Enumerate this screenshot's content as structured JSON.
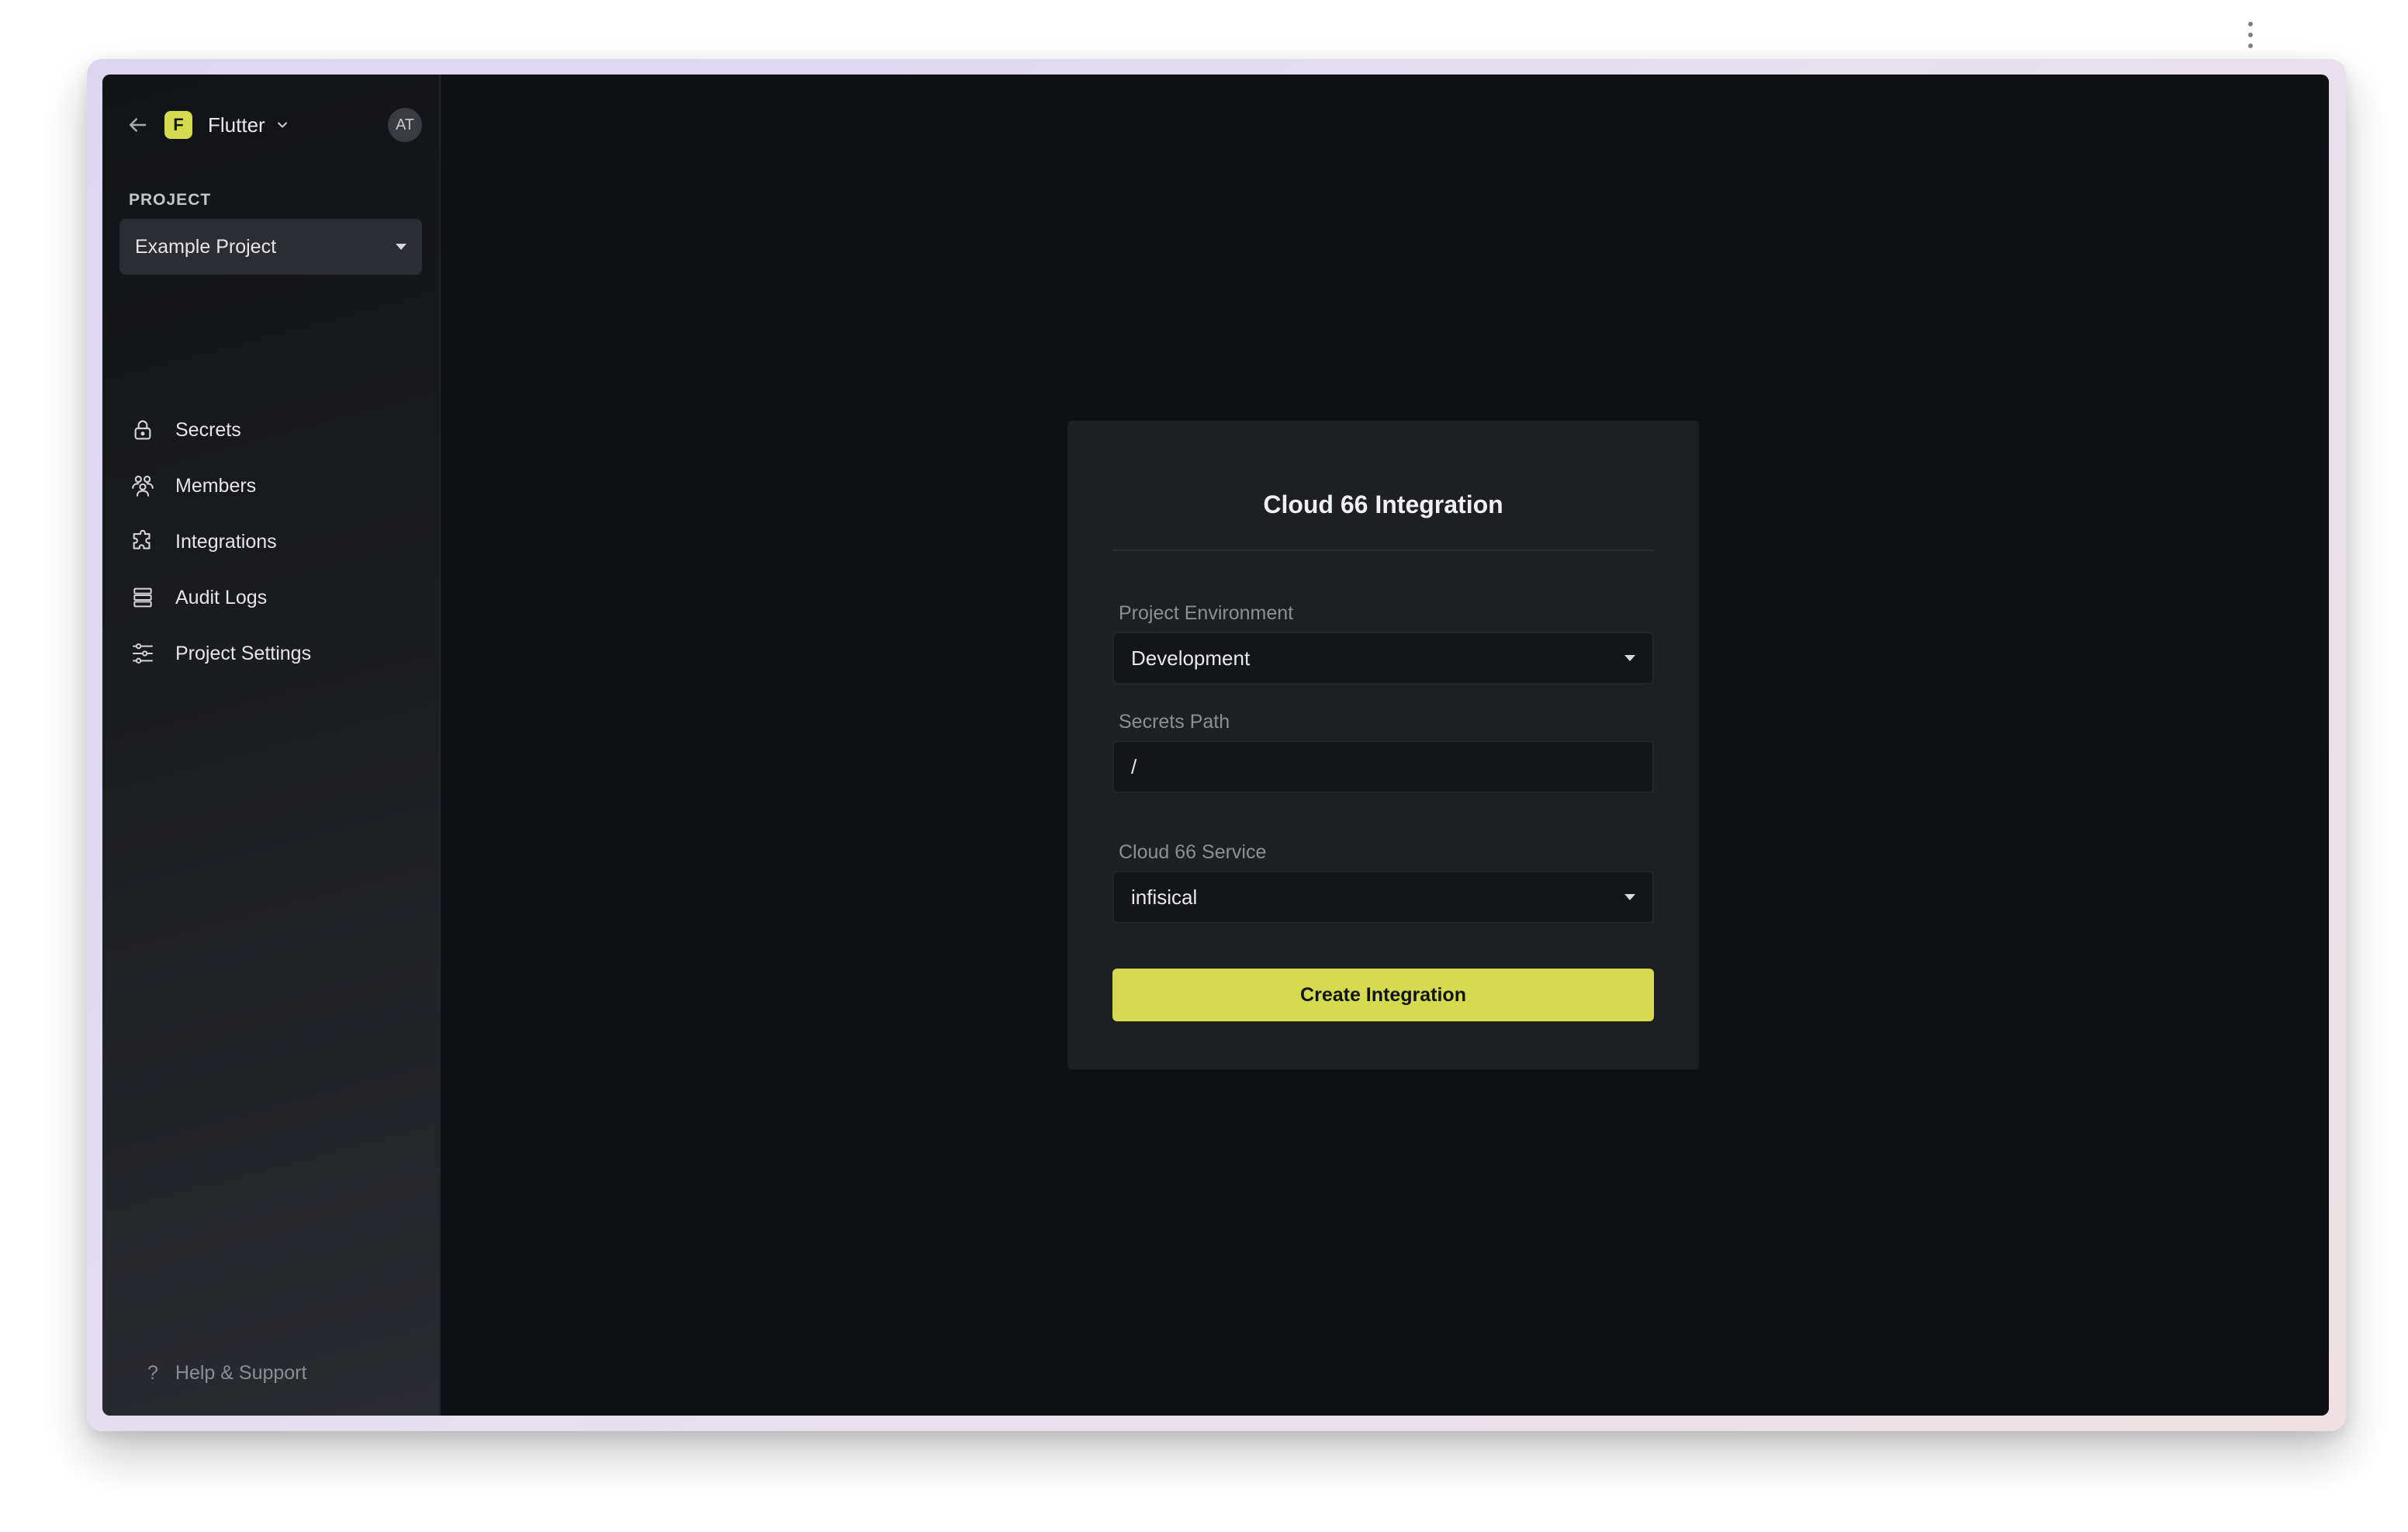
{
  "sidebar": {
    "org": {
      "badge": "F",
      "name": "Flutter"
    },
    "user_initials": "AT",
    "project_label": "PROJECT",
    "project_selected": "Example Project",
    "nav": [
      {
        "label": "Secrets",
        "icon": "lock-icon"
      },
      {
        "label": "Members",
        "icon": "members-icon"
      },
      {
        "label": "Integrations",
        "icon": "puzzle-icon"
      },
      {
        "label": "Audit Logs",
        "icon": "audit-logs-icon"
      },
      {
        "label": "Project Settings",
        "icon": "sliders-icon"
      }
    ],
    "help": {
      "icon": "?",
      "label": "Help & Support"
    }
  },
  "card": {
    "title": "Cloud 66 Integration",
    "environment": {
      "label": "Project Environment",
      "value": "Development"
    },
    "secrets_path": {
      "label": "Secrets Path",
      "value": "/"
    },
    "service": {
      "label": "Cloud 66 Service",
      "value": "infisical"
    },
    "create_label": "Create Integration"
  },
  "colors": {
    "accent": "#d4db4e",
    "background": "#0f1013",
    "card": "#1e1f22",
    "sidebar": "#1b1c20"
  }
}
